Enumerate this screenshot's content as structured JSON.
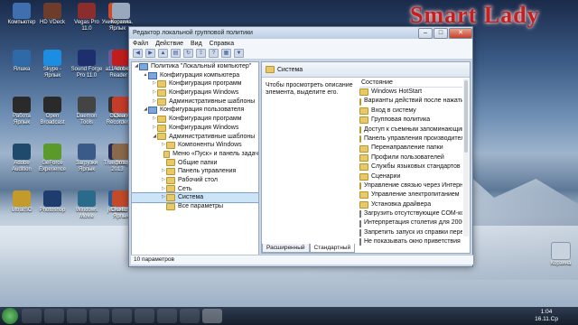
{
  "watermark": "Smart Lady",
  "desktop_icons": [
    {
      "label": "Компьютер",
      "color": "#3f6fae"
    },
    {
      "label": "HD VDeck",
      "color": "#6e3c2a"
    },
    {
      "label": "Vegas Pro 11.0",
      "color": "#8b2d2d"
    },
    {
      "label": "Универсаль. Ярлык",
      "color": "#d04a2a"
    },
    {
      "label": "Корзина",
      "color": "#9aa8bb"
    },
    {
      "label": "Ялшка",
      "color": "#2f6aa8"
    },
    {
      "label": "Skype - Ярлык",
      "color": "#1c8de0"
    },
    {
      "label": "Sound Forge Pro 11.0",
      "color": "#1e2f6e"
    },
    {
      "label": "a11-lem-e",
      "color": "#6a5a9a"
    },
    {
      "label": "Adobe Reader X",
      "color": "#c21d1d"
    },
    {
      "label": "Работа Ярлык",
      "color": "#2a2a2a"
    },
    {
      "label": "Open Broadcast",
      "color": "#2a2a2a"
    },
    {
      "label": "Daemon Tools",
      "color": "#444"
    },
    {
      "label": "Экран Recorder",
      "color": "#333"
    },
    {
      "label": "CCleaner",
      "color": "#c43c2a"
    },
    {
      "label": "Adobe Audition",
      "color": "#1f4a6b"
    },
    {
      "label": "GeForce Experience",
      "color": "#5a9a2a"
    },
    {
      "label": "Загрузки Ярлык",
      "color": "#3a5a8a"
    },
    {
      "label": "True Image 2013",
      "color": "#2a2a5a"
    },
    {
      "label": "фото",
      "color": "#8a6a4a"
    },
    {
      "label": "UltraISO",
      "color": "#c49a2a"
    },
    {
      "label": "Photoshop",
      "color": "#1e3c6e"
    },
    {
      "label": "Windows Movie",
      "color": "#2a6a8a"
    },
    {
      "label": "jetAudio",
      "color": "#2a5a9a"
    },
    {
      "label": "Скачать Ярлык",
      "color": "#c44a2a"
    }
  ],
  "right_icons": [
    {
      "label": "Корзина"
    }
  ],
  "window": {
    "title": "Редактор локальной групповой политики",
    "menu": [
      "Файл",
      "Действие",
      "Вид",
      "Справка"
    ],
    "tree": [
      {
        "label": "Политика \"Локальный компьютер\"",
        "level": 0,
        "twisty": "◢",
        "icon": "pc"
      },
      {
        "label": "Конфигурация компьютера",
        "level": 1,
        "twisty": "▲",
        "icon": "pc"
      },
      {
        "label": "Конфигурация программ",
        "level": 2,
        "twisty": "▷",
        "icon": "folder"
      },
      {
        "label": "Конфигурация Windows",
        "level": 2,
        "twisty": "▷",
        "icon": "folder"
      },
      {
        "label": "Административные шаблоны",
        "level": 2,
        "twisty": "▷",
        "icon": "folder"
      },
      {
        "label": "Конфигурация пользователя",
        "level": 1,
        "twisty": "◢",
        "icon": "pc"
      },
      {
        "label": "Конфигурация программ",
        "level": 2,
        "twisty": "▷",
        "icon": "folder"
      },
      {
        "label": "Конфигурация Windows",
        "level": 2,
        "twisty": "▷",
        "icon": "folder"
      },
      {
        "label": "Административные шаблоны",
        "level": 2,
        "twisty": "◢",
        "icon": "folder"
      },
      {
        "label": "Компоненты Windows",
        "level": 3,
        "twisty": "▷",
        "icon": "folder"
      },
      {
        "label": "Меню «Пуск» и панель задач",
        "level": 3,
        "twisty": "",
        "icon": "folder"
      },
      {
        "label": "Общие папки",
        "level": 3,
        "twisty": "",
        "icon": "folder"
      },
      {
        "label": "Панель управления",
        "level": 3,
        "twisty": "▷",
        "icon": "folder"
      },
      {
        "label": "Рабочий стол",
        "level": 3,
        "twisty": "▷",
        "icon": "folder"
      },
      {
        "label": "Сеть",
        "level": 3,
        "twisty": "▷",
        "icon": "folder"
      },
      {
        "label": "Система",
        "level": 3,
        "twisty": "▷",
        "icon": "folder",
        "selected": true
      },
      {
        "label": "Все параметры",
        "level": 3,
        "twisty": "",
        "icon": "folder"
      }
    ],
    "right_title": "Система",
    "description": "Чтобы просмотреть описание элемента, выделите его.",
    "list_header": "Состояние",
    "list_items": [
      {
        "label": "Windows HotStart",
        "icon": "folder"
      },
      {
        "label": "Варианты действий после нажатия CTR",
        "icon": "folder"
      },
      {
        "label": "Вход в систему",
        "icon": "folder"
      },
      {
        "label": "Групповая политика",
        "icon": "folder"
      },
      {
        "label": "Доступ к съемным запоминающим уст",
        "icon": "folder"
      },
      {
        "label": "Панель управления производительнос",
        "icon": "folder"
      },
      {
        "label": "Перенаправление папки",
        "icon": "folder"
      },
      {
        "label": "Профили пользователей",
        "icon": "folder"
      },
      {
        "label": "Службы языковых стандартов",
        "icon": "folder"
      },
      {
        "label": "Сценарии",
        "icon": "folder"
      },
      {
        "label": "Управление связью через Интернет",
        "icon": "folder"
      },
      {
        "label": "Управление электропитанием",
        "icon": "folder"
      },
      {
        "label": "Установка драйвера",
        "icon": "folder"
      },
      {
        "label": "Загрузить отсутствующие COM-компо",
        "icon": "setting"
      },
      {
        "label": "Интерпретация столетия для 2000 года",
        "icon": "setting"
      },
      {
        "label": "Запретить запуск из справки перечисл",
        "icon": "setting"
      },
      {
        "label": "Не показывать окно приветствия \"При",
        "icon": "setting"
      }
    ],
    "tabs": [
      "Расширенный",
      "Стандартный"
    ],
    "status": "10 параметров"
  },
  "taskbar": {
    "time": "1:04",
    "date": "16.11.Ср"
  }
}
